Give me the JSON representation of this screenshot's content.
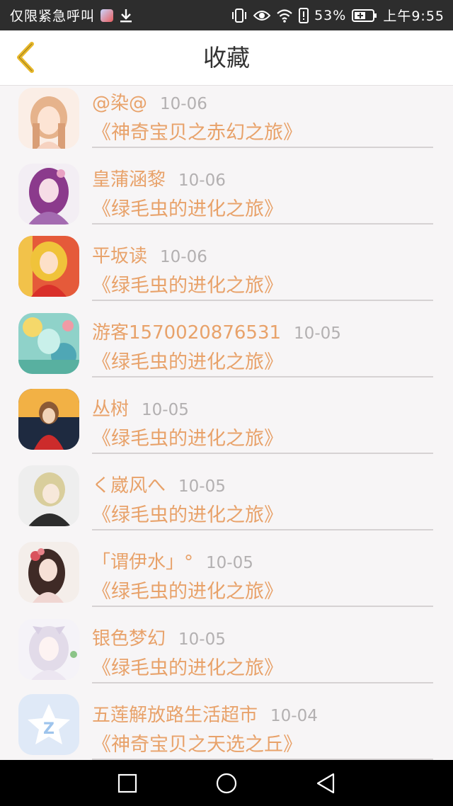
{
  "status_bar": {
    "left_text": "仅限紧急呼叫",
    "icons": [
      "app-notification-icon",
      "download-icon",
      "vibrate-icon",
      "eye-icon",
      "wifi-icon",
      "battery-alert-icon",
      "battery-charging-icon"
    ],
    "battery_percent": "53%",
    "time": "上午9:55"
  },
  "header": {
    "title": "收藏",
    "back_icon": "chevron-left-icon",
    "accent_color": "#e8b82a"
  },
  "colors": {
    "name_color": "#e8a26a",
    "date_color": "#b3b0b1",
    "background": "#f7f5f6"
  },
  "favorites": [
    {
      "name": "@染@",
      "date": "10-06",
      "title": "《神奇宝贝之赤幻之旅》",
      "avatar": "anime-girl-light-hair-avatar"
    },
    {
      "name": "皇蒲涵黎",
      "date": "10-06",
      "title": "《绿毛虫的进化之旅》",
      "avatar": "anime-girl-purple-hair-avatar"
    },
    {
      "name": "平坂读",
      "date": "10-06",
      "title": "《绿毛虫的进化之旅》",
      "avatar": "anime-girl-blonde-avatar"
    },
    {
      "name": "游客1570020876531",
      "date": "10-05",
      "title": "《绿毛虫的进化之旅》",
      "avatar": "anime-teal-hair-avatar"
    },
    {
      "name": "丛树",
      "date": "10-05",
      "title": "《绿毛虫的进化之旅》",
      "avatar": "anime-boy-sunset-avatar"
    },
    {
      "name": "く崴风へ",
      "date": "10-05",
      "title": "《绿毛虫的进化之旅》",
      "avatar": "anime-boy-blonde-avatar"
    },
    {
      "name": "「谓伊水」°",
      "date": "10-05",
      "title": "《绿毛虫的进化之旅》",
      "avatar": "anime-girl-flower-avatar"
    },
    {
      "name": "银色梦幻",
      "date": "10-05",
      "title": "《绿毛虫的进化之旅》",
      "avatar": "anime-girl-white-hair-avatar"
    },
    {
      "name": "五莲解放路生活超市",
      "date": "10-04",
      "title": "《神奇宝贝之天选之丘》",
      "avatar": "qq-star-avatar"
    }
  ],
  "nav_bar": {
    "recent_icon": "square-recent-apps-icon",
    "home_icon": "circle-home-icon",
    "back_icon": "triangle-back-icon"
  }
}
